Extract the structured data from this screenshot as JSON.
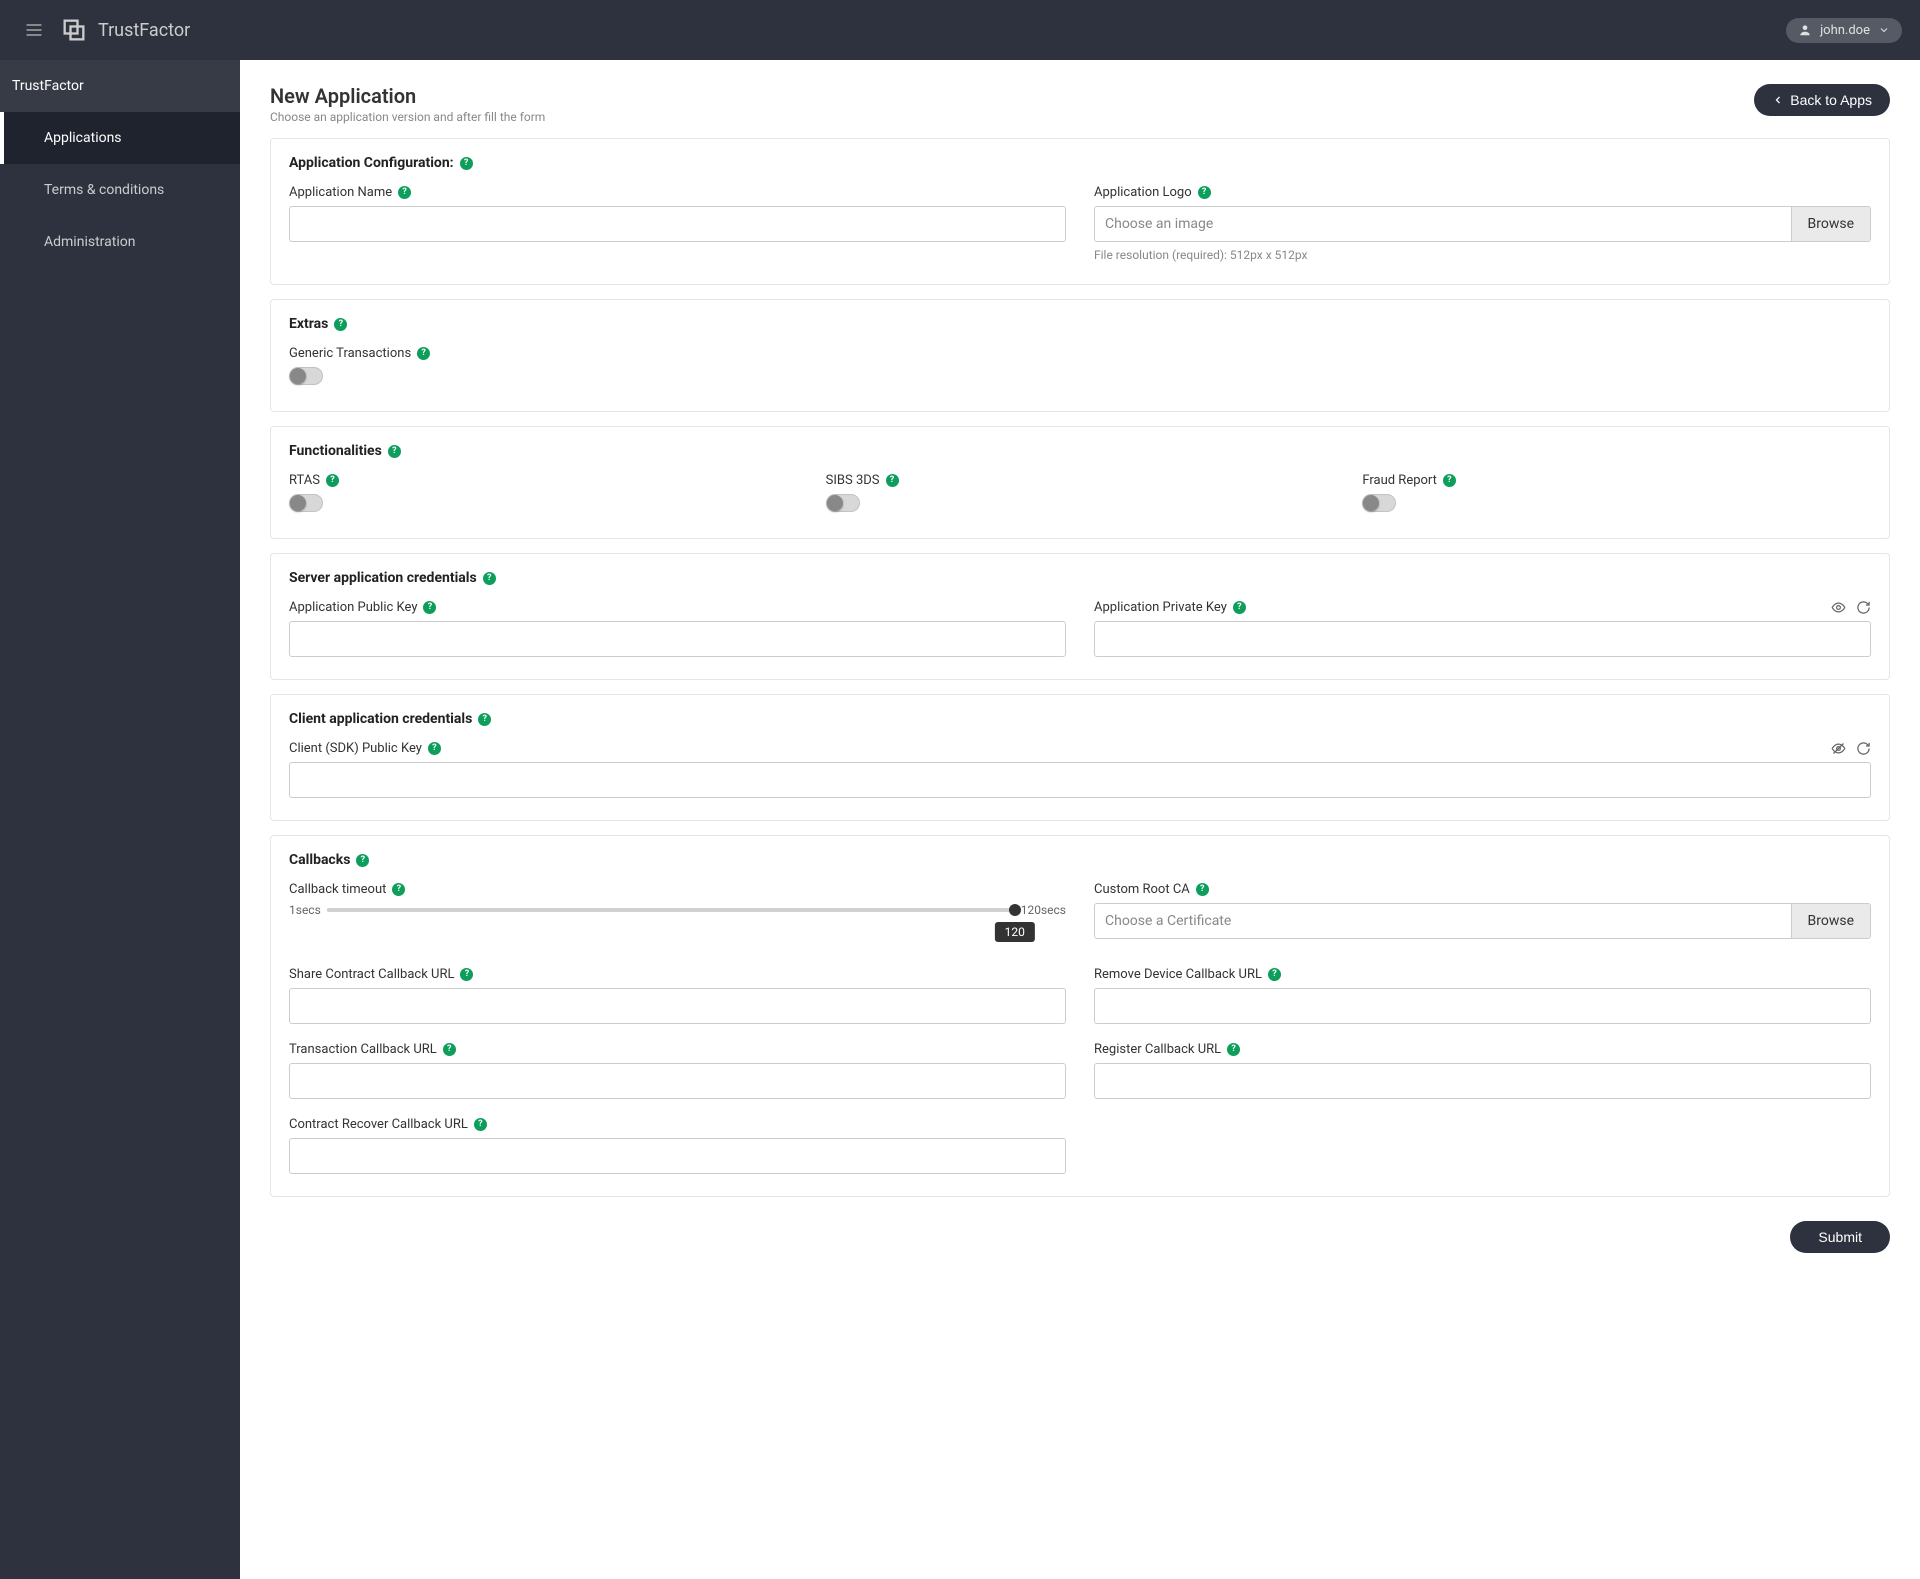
{
  "app": {
    "name": "TrustFactor"
  },
  "user": {
    "name": "john.doe"
  },
  "sidebar": {
    "header": "TrustFactor",
    "items": [
      {
        "label": "Applications",
        "active": true
      },
      {
        "label": "Terms & conditions",
        "active": false
      },
      {
        "label": "Administration",
        "active": false
      }
    ]
  },
  "page": {
    "title": "New Application",
    "subtitle": "Choose an application version and after fill the form",
    "back_label": "Back to Apps",
    "submit_label": "Submit"
  },
  "panels": {
    "app_config": {
      "title": "Application Configuration:",
      "app_name_label": "Application Name",
      "app_logo_label": "Application Logo",
      "logo_placeholder": "Choose an image",
      "browse_label": "Browse",
      "logo_hint": "File resolution (required): 512px x 512px"
    },
    "extras": {
      "title": "Extras",
      "generic_tx_label": "Generic Transactions"
    },
    "functionalities": {
      "title": "Functionalities",
      "rtas_label": "RTAS",
      "sibs_label": "SIBS 3DS",
      "fraud_label": "Fraud Report"
    },
    "server_creds": {
      "title": "Server application credentials",
      "public_label": "Application Public Key",
      "private_label": "Application Private Key"
    },
    "client_creds": {
      "title": "Client application credentials",
      "sdk_label": "Client (SDK) Public Key"
    },
    "callbacks": {
      "title": "Callbacks",
      "timeout_label": "Callback timeout",
      "timeout_min": "1secs",
      "timeout_max": "120secs",
      "timeout_value": "120",
      "root_ca_label": "Custom Root CA",
      "root_ca_placeholder": "Choose a Certificate",
      "browse_label": "Browse",
      "share_label": "Share Contract Callback URL",
      "remove_label": "Remove Device Callback URL",
      "tx_label": "Transaction Callback URL",
      "register_label": "Register Callback URL",
      "recover_label": "Contract Recover Callback URL"
    }
  }
}
